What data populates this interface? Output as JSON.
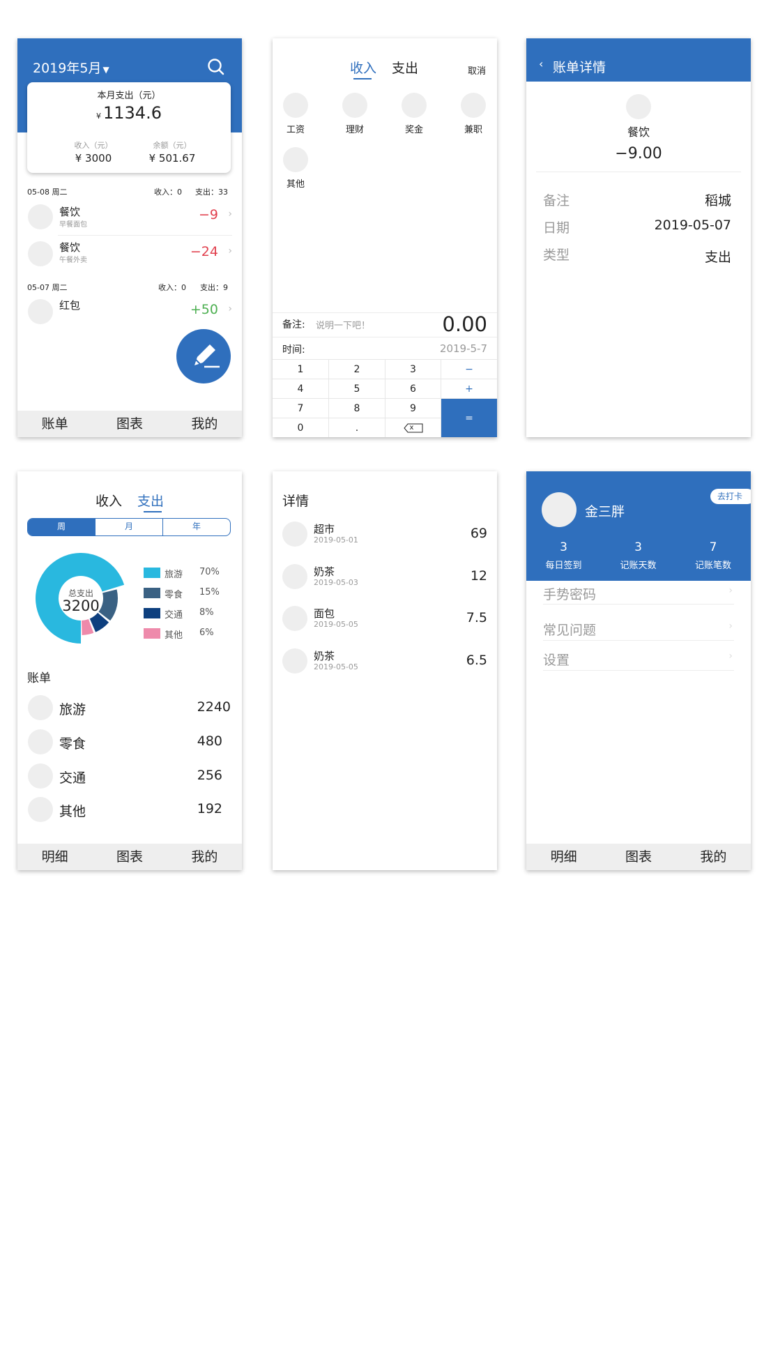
{
  "screen1": {
    "month": "2019年5月",
    "card": {
      "title": "本月支出（元）",
      "amount_prefix": "¥",
      "amount": "1134.6",
      "income_label": "收入（元）",
      "income_value": "¥ 3000",
      "balance_label": "余额（元）",
      "balance_value": "¥ 501.67"
    },
    "groups": [
      {
        "date": "05-08 周二",
        "income": "收入：0",
        "expense": "支出：33",
        "items": [
          {
            "title": "餐饮",
            "sub": "早餐面包",
            "amount": "−9",
            "color": "#e1404e"
          },
          {
            "title": "餐饮",
            "sub": "午餐外卖",
            "amount": "−24",
            "color": "#e1404e"
          }
        ]
      },
      {
        "date": "05-07 周二",
        "income": "收入：0",
        "expense": "支出：9",
        "items": [
          {
            "title": "红包",
            "sub": "",
            "amount": "+50",
            "color": "#4caf50"
          }
        ]
      }
    ],
    "tabs": [
      "账单",
      "图表",
      "我的"
    ]
  },
  "screen2": {
    "tab_income": "收入",
    "tab_expense": "支出",
    "cancel": "取消",
    "categories": [
      "工资",
      "理财",
      "奖金",
      "兼职",
      "其他"
    ],
    "note_label": "备注:",
    "note_placeholder": "说明一下吧！",
    "amount": "0.00",
    "time_label": "时间:",
    "time_value": "2019-5-7",
    "keys": [
      "1",
      "2",
      "3",
      "−",
      "4",
      "5",
      "6",
      "+",
      "7",
      "8",
      "9",
      "0",
      ".",
      "x",
      "="
    ]
  },
  "screen3": {
    "title": "账单详情",
    "category": "餐饮",
    "amount": "−9.00",
    "rows": [
      {
        "label": "备注",
        "value": "稻城"
      },
      {
        "label": "日期",
        "value": "2019-05-07"
      },
      {
        "label": "类型",
        "value": "支出"
      }
    ]
  },
  "screen4": {
    "tab_income": "收入",
    "tab_expense": "支出",
    "periods": [
      "周",
      "月",
      "年"
    ],
    "donut_label": "总支出",
    "donut_value": "3200",
    "section_title": "账单",
    "list": [
      {
        "name": "旅游",
        "value": "2240"
      },
      {
        "name": "零食",
        "value": "480"
      },
      {
        "name": "交通",
        "value": "256"
      },
      {
        "name": "其他",
        "value": "192"
      }
    ],
    "tabs": [
      "明细",
      "图表",
      "我的"
    ]
  },
  "chart_data": {
    "type": "pie",
    "categories": [
      "旅游",
      "零食",
      "交通",
      "其他"
    ],
    "values": [
      70,
      15,
      8,
      6
    ],
    "value_labels": [
      "70%",
      "15%",
      "8%",
      "6%"
    ],
    "colors": [
      "#29b8df",
      "#3a6183",
      "#0d3f7e",
      "#ee8aab"
    ],
    "title": "",
    "legend": "right"
  },
  "screen5": {
    "title": "详情",
    "items": [
      {
        "name": "超市",
        "date": "2019-05-01",
        "value": "69"
      },
      {
        "name": "奶茶",
        "date": "2019-05-03",
        "value": "12"
      },
      {
        "name": "面包",
        "date": "2019-05-05",
        "value": "7.5"
      },
      {
        "name": "奶茶",
        "date": "2019-05-05",
        "value": "6.5"
      }
    ]
  },
  "screen6": {
    "username": "金三胖",
    "checkin_button": "去打卡",
    "stats": [
      {
        "value": "3",
        "label": "每日签到"
      },
      {
        "value": "3",
        "label": "记账天数"
      },
      {
        "value": "7",
        "label": "记账笔数"
      }
    ],
    "menu": [
      "手势密码",
      "常见问题",
      "设置"
    ],
    "tabs": [
      "明细",
      "图表",
      "我的"
    ]
  },
  "colors": {
    "primary": "#2f6fbd",
    "expense_red": "#e1404e",
    "income_green": "#4caf50",
    "tabbar_bg": "#eeeeee"
  }
}
